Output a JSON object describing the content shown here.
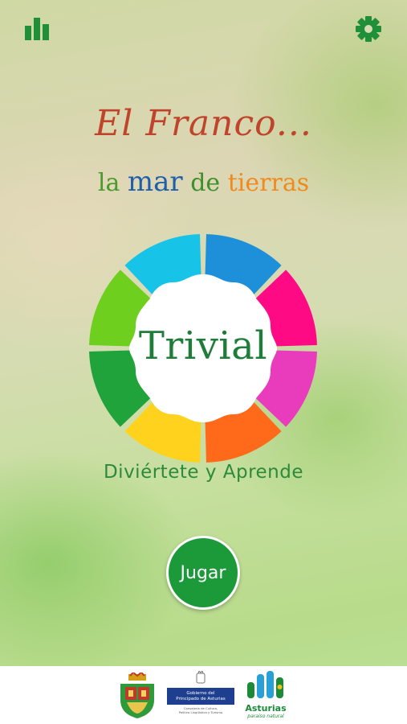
{
  "header": {
    "stats_icon": "bar-chart-icon",
    "settings_icon": "gear-icon",
    "icon_color": "#1f8f3a"
  },
  "title": {
    "line1": "El Franco...",
    "line2_words": [
      "la",
      "mar",
      "de",
      "tierras"
    ]
  },
  "wheel": {
    "label": "Trivial",
    "segment_colors": [
      "#1e8fd9",
      "#ff0a85",
      "#e83cbc",
      "#ff6a1a",
      "#ffd21e",
      "#1fa33a",
      "#6fcf1f",
      "#17c4e8"
    ]
  },
  "subtitle": "Diviértete y Aprende",
  "play_button": {
    "label": "Jugar",
    "color": "#1c9a3a"
  },
  "footer": {
    "gov_logo": {
      "line1": "Gobierno del",
      "line2": "Principado de Asturias",
      "sub1": "Consejería de Cultura,",
      "sub2": "Política Lingüística y Turismo"
    },
    "asturias_logo": {
      "name": "Asturias",
      "tagline": "paraíso natural"
    }
  }
}
